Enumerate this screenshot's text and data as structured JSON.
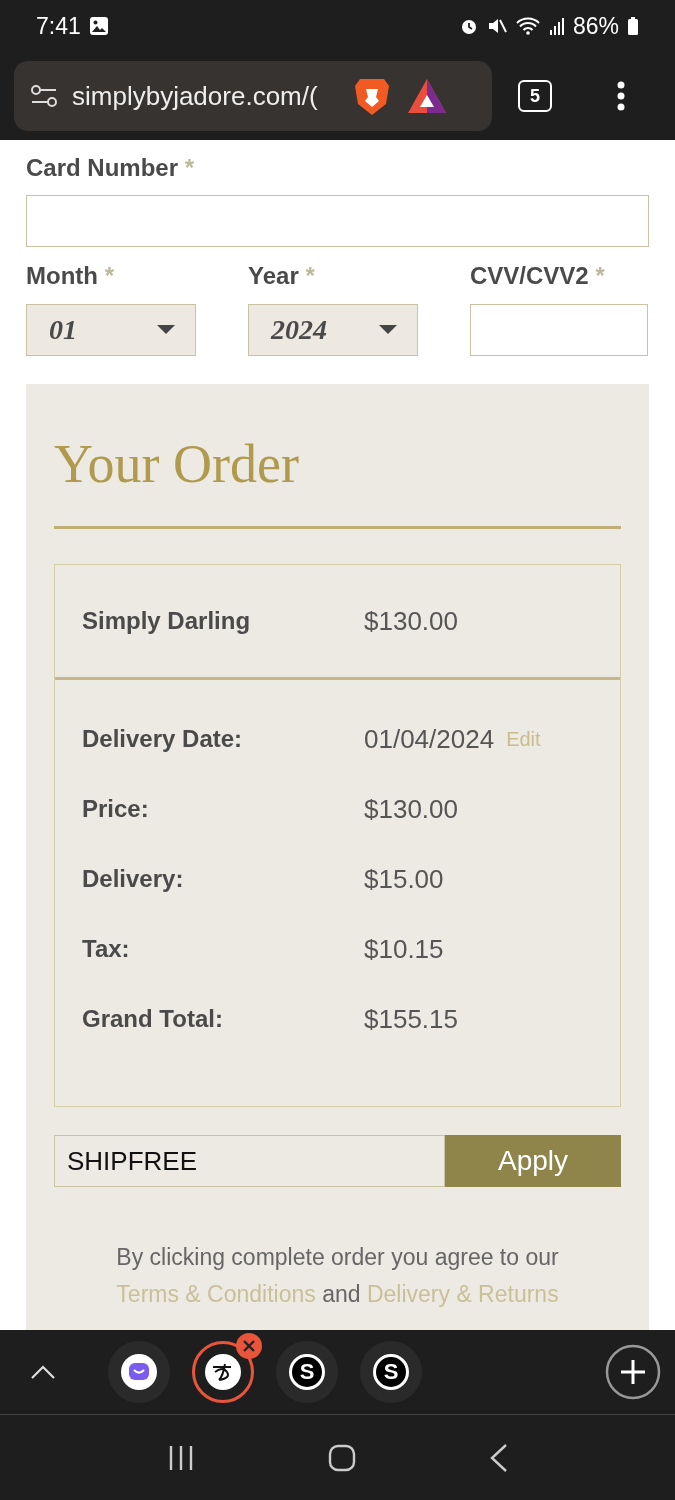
{
  "status_bar": {
    "time": "7:41",
    "battery": "86%"
  },
  "browser": {
    "url": "simplybyjadore.com/(",
    "tab_count": "5"
  },
  "payment": {
    "card_number": {
      "label": "Card Number",
      "mark": "*"
    },
    "month": {
      "label": "Month",
      "mark": "*",
      "value": "01"
    },
    "year": {
      "label": "Year",
      "mark": "*",
      "value": "2024"
    },
    "cvv": {
      "label": "CVV/CVV2",
      "mark": "*"
    }
  },
  "order": {
    "title": "Your Order",
    "product": {
      "name": "Simply Darling",
      "price": "$130.00"
    },
    "details": [
      {
        "label": "Delivery Date:",
        "value": "01/04/2024",
        "action": "Edit"
      },
      {
        "label": "Price:",
        "value": "$130.00"
      },
      {
        "label": "Delivery:",
        "value": "$15.00"
      },
      {
        "label": "Tax:",
        "value": "$10.15"
      },
      {
        "label": "Grand Total:",
        "value": "$155.15"
      }
    ],
    "coupon": {
      "value": "SHIPFREE",
      "button": "Apply"
    },
    "agreement": {
      "text": "By clicking complete order you agree to our",
      "link_1": "Terms & Conditions",
      "joiner": "and",
      "link_2": "Delivery & Returns"
    }
  },
  "app_dock": {
    "apps": [
      {
        "kind": "chat",
        "selected": false
      },
      {
        "kind": "signature",
        "selected": true
      },
      {
        "kind": "letter",
        "label": "S",
        "selected": false
      },
      {
        "kind": "letter",
        "label": "S",
        "selected": false
      }
    ]
  }
}
